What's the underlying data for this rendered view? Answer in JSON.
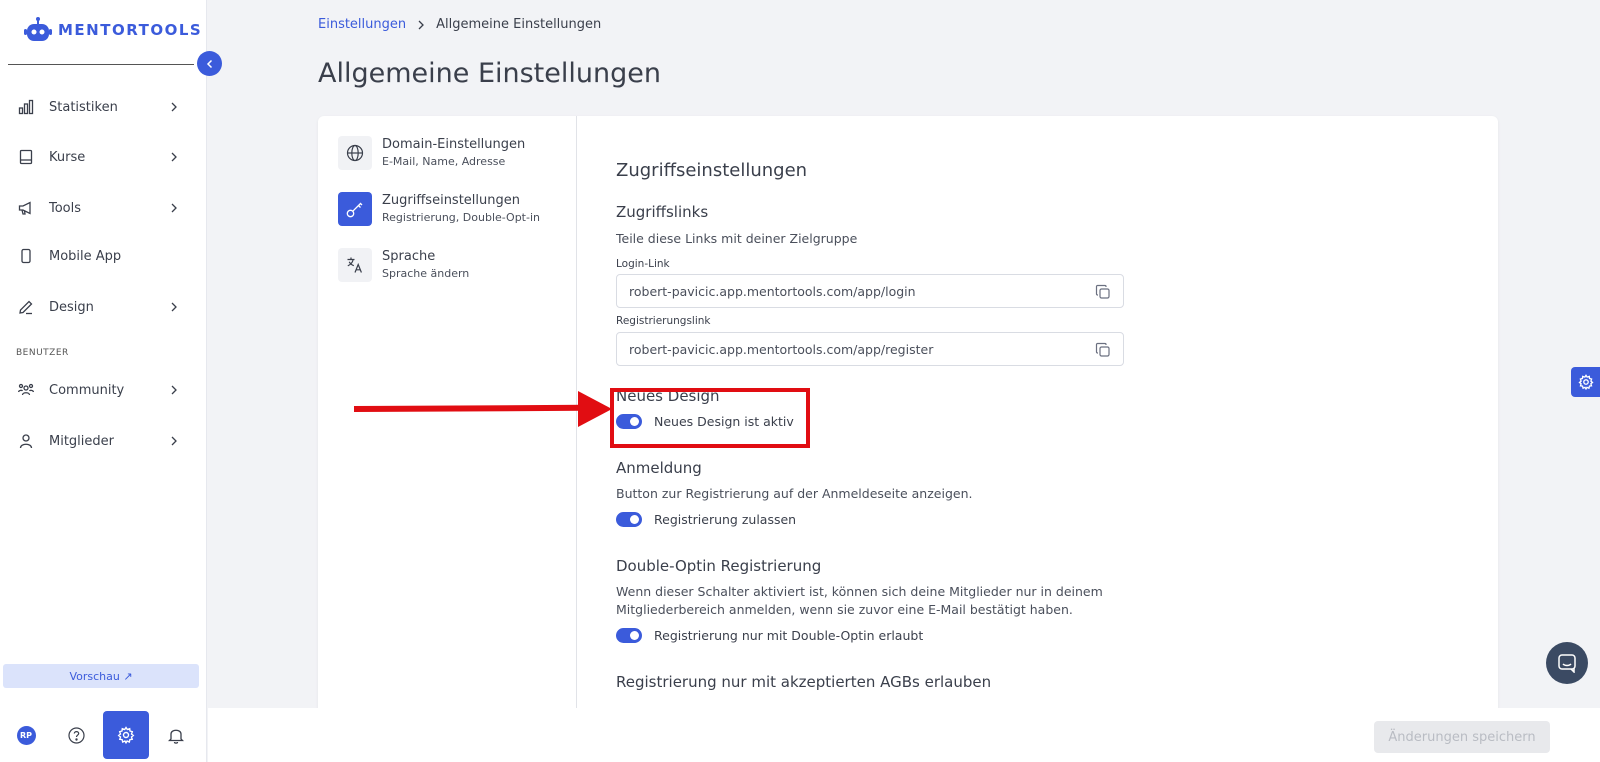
{
  "brand": {
    "name": "MENTORTOOLS",
    "accent": "#3b5bdb"
  },
  "sidebar": {
    "items": [
      {
        "label": "Statistiken",
        "icon": "bar-chart-icon"
      },
      {
        "label": "Kurse",
        "icon": "book-icon"
      },
      {
        "label": "Tools",
        "icon": "megaphone-icon"
      },
      {
        "label": "Mobile App",
        "icon": "smartphone-icon"
      },
      {
        "label": "Design",
        "icon": "pencil-icon"
      },
      {
        "label": "Community",
        "icon": "users-icon"
      },
      {
        "label": "Mitglieder",
        "icon": "user-icon"
      }
    ],
    "section_label": "BENUTZER",
    "preview_label": "Vorschau ↗",
    "avatar_initials": "RP"
  },
  "breadcrumb": {
    "parent": "Einstellungen",
    "current": "Allgemeine Einstellungen"
  },
  "page_title": "Allgemeine Einstellungen",
  "subnav": [
    {
      "title": "Domain-Einstellungen",
      "desc": "E-Mail, Name, Adresse",
      "icon": "globe-icon"
    },
    {
      "title": "Zugriffseinstellungen",
      "desc": "Registrierung, Double-Opt-in",
      "icon": "key-icon",
      "active": true
    },
    {
      "title": "Sprache",
      "desc": "Sprache ändern",
      "icon": "translate-icon"
    }
  ],
  "content": {
    "title": "Zugriffseinstellungen",
    "links_title": "Zugriffslinks",
    "links_desc": "Teile diese Links mit deiner Zielgruppe",
    "login_label": "Login-Link",
    "login_value": "robert-pavicic.app.mentortools.com/app/login",
    "register_label": "Registrierungslink",
    "register_value": "robert-pavicic.app.mentortools.com/app/register",
    "design_title": "Neues Design",
    "design_toggle": "Neues Design ist aktiv",
    "login_section_title": "Anmeldung",
    "login_section_desc": "Button zur Registrierung auf der Anmeldeseite anzeigen.",
    "login_toggle": "Registrierung zulassen",
    "doi_title": "Double-Optin Registrierung",
    "doi_desc_1": "Wenn dieser Schalter aktiviert ist, können sich deine Mitglieder nur in deinem",
    "doi_desc_2": "Mitgliederbereich anmelden, wenn sie zuvor eine E-Mail bestätigt haben.",
    "doi_toggle": "Registrierung nur mit Double-Optin erlaubt",
    "agb_title": "Registrierung nur mit akzeptierten AGBs erlauben"
  },
  "footer": {
    "save_label": "Änderungen speichern"
  }
}
